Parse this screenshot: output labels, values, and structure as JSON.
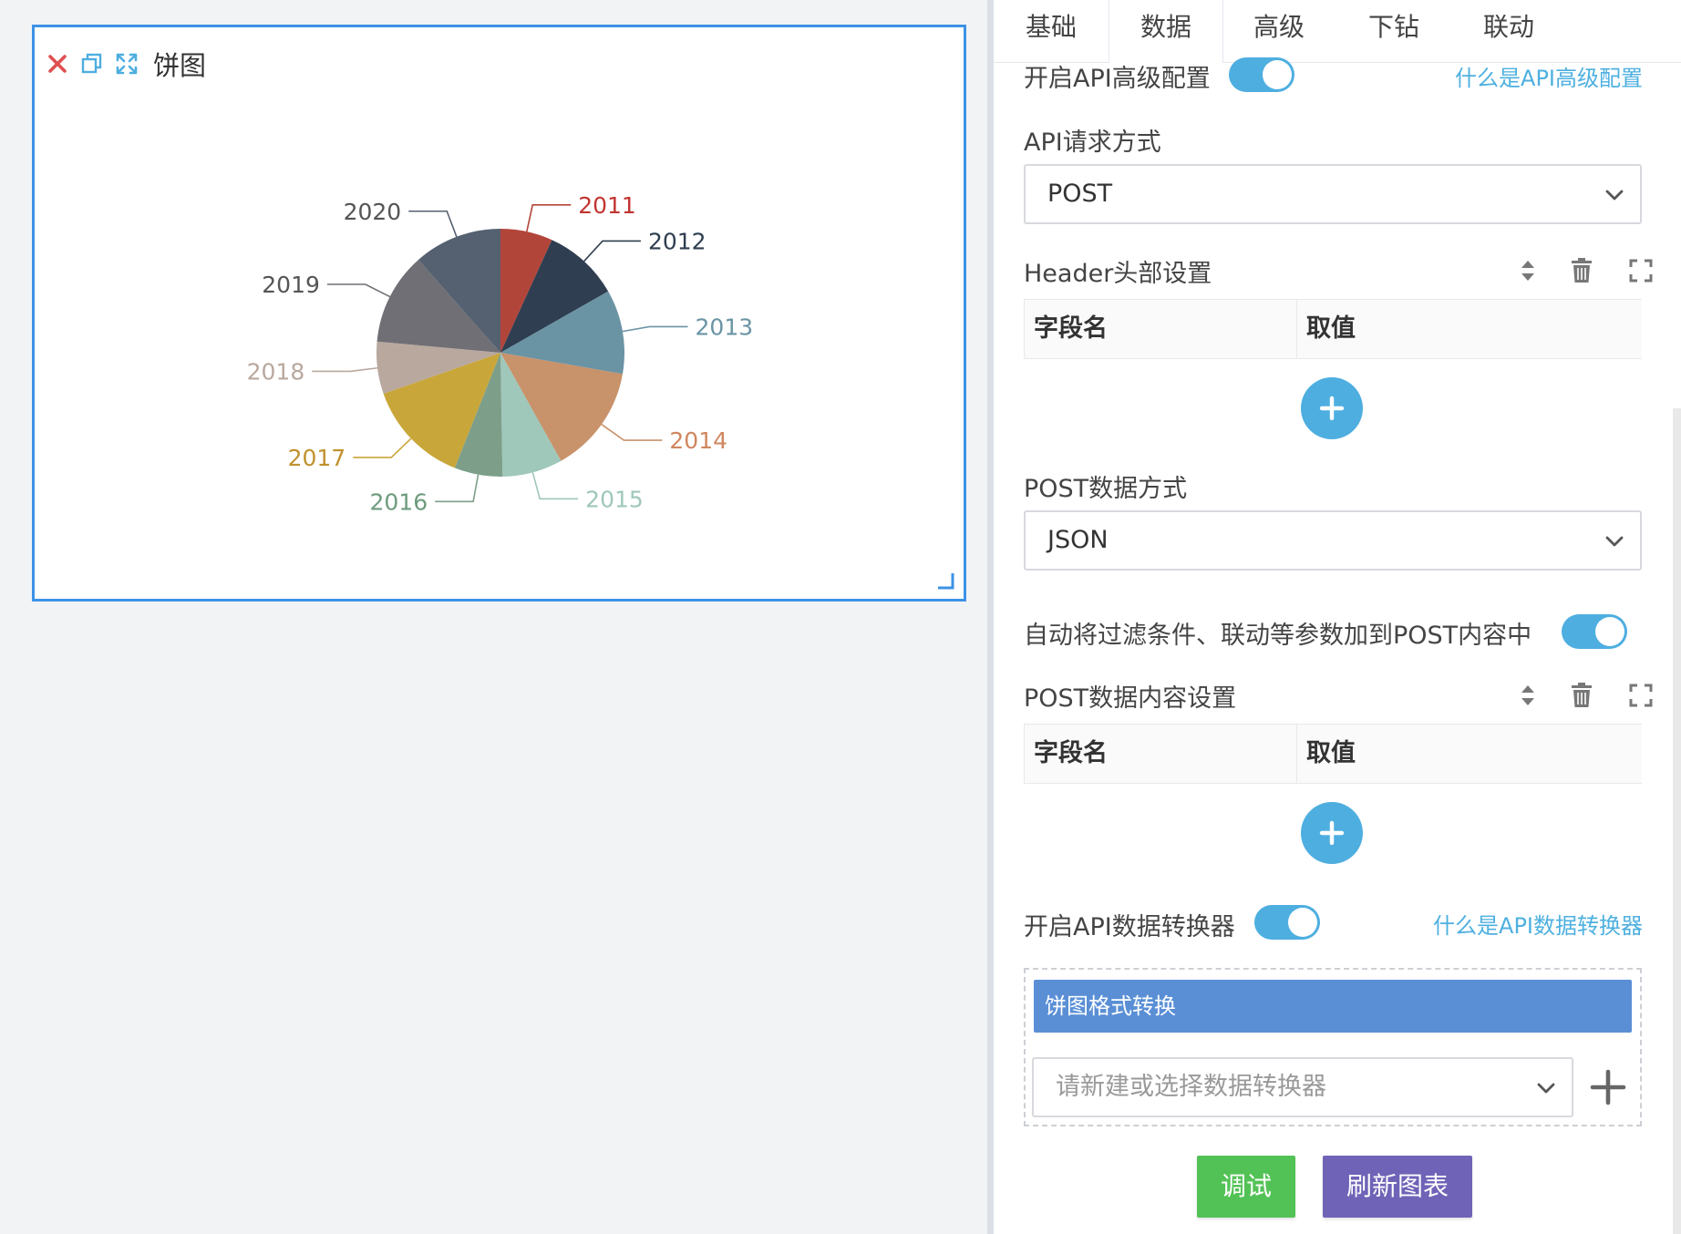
{
  "canvas": {
    "card_title": "饼图",
    "colors": {
      "border": "#3d92e6",
      "close": "#e04f4f",
      "tool": "#4eaee0"
    }
  },
  "chart_data": {
    "type": "pie",
    "categories": [
      "2011",
      "2012",
      "2013",
      "2014",
      "2015",
      "2016",
      "2017",
      "2018",
      "2019",
      "2020"
    ],
    "values": [
      6.5,
      9.5,
      10.5,
      13.5,
      7.5,
      6.0,
      13.0,
      6.5,
      11.5,
      11.0
    ],
    "colors": [
      "#b2453a",
      "#2f3e50",
      "#6a94a4",
      "#c8926a",
      "#9fc7ba",
      "#7d9f8a",
      "#c9a639",
      "#b9a89e",
      "#6f6f75",
      "#556170"
    ],
    "label_colors": [
      "#c23531",
      "#2f3e50",
      "#6a94a4",
      "#d0865e",
      "#9fc7ba",
      "#6e9b7e",
      "#c0912d",
      "#b9a89e",
      "#555",
      "#555"
    ],
    "title": "",
    "legend": "none"
  },
  "panel": {
    "tabs": [
      {
        "label": "基础"
      },
      {
        "label": "数据"
      },
      {
        "label": "高级"
      },
      {
        "label": "下钻"
      },
      {
        "label": "联动"
      }
    ],
    "active_tab": "数据",
    "api_advanced": {
      "label": "开启API高级配置",
      "help": "什么是API高级配置",
      "enabled": true
    },
    "request_method": {
      "label": "API请求方式",
      "value": "POST"
    },
    "header": {
      "label": "Header头部设置",
      "col_name": "字段名",
      "col_value": "取值"
    },
    "post_mode": {
      "label": "POST数据方式",
      "value": "JSON"
    },
    "auto_params": {
      "label": "自动将过滤条件、联动等参数加到POST内容中",
      "enabled": true
    },
    "post_body": {
      "label": "POST数据内容设置",
      "col_name": "字段名",
      "col_value": "取值"
    },
    "converter": {
      "label": "开启API数据转换器",
      "help": "什么是API数据转换器",
      "enabled": true,
      "selected_item": "饼图格式转换",
      "select_placeholder": "请新建或选择数据转换器"
    },
    "buttons": {
      "debug": "调试",
      "refresh": "刷新图表"
    },
    "colors": {
      "accent": "#4eaee0",
      "debug": "#53c256",
      "refresh": "#6f63b7",
      "converter_item": "#5a8fd6"
    }
  }
}
